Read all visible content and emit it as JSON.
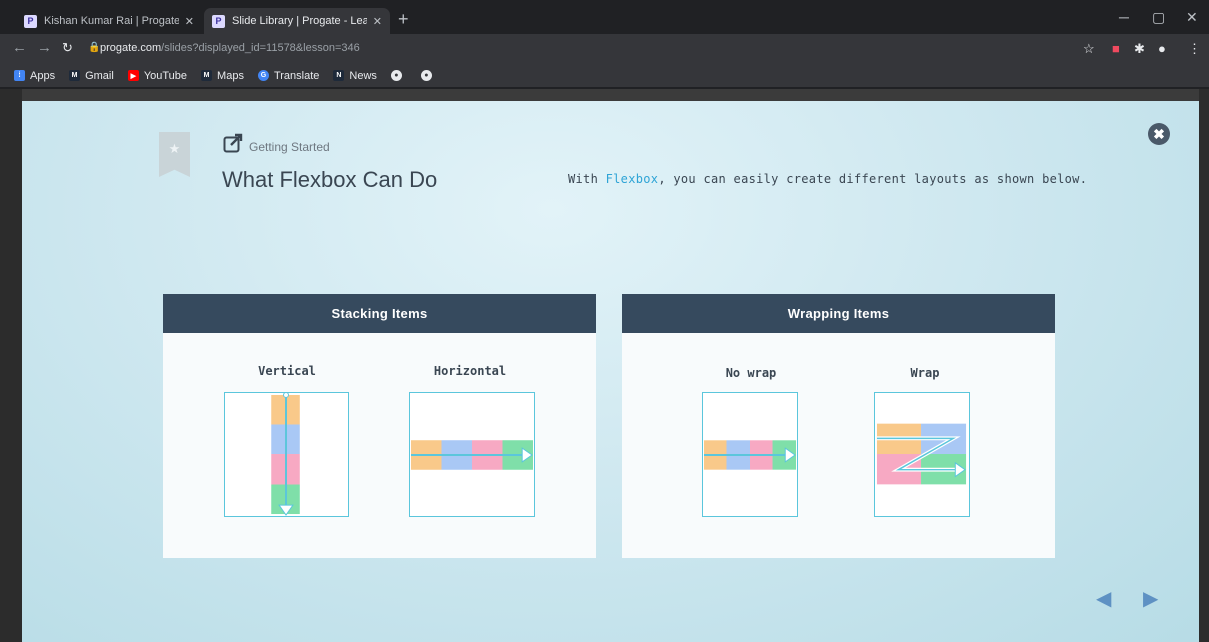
{
  "browser": {
    "tabs": [
      {
        "title": "Kishan Kumar Rai | Progate - Lea",
        "favicon": "P",
        "active": false
      },
      {
        "title": "Slide Library | Progate - Learn to",
        "favicon": "P",
        "active": true
      }
    ],
    "url_host": "progate.com",
    "url_path": "/slides?displayed_id=11578&lesson=346",
    "bookmarks": [
      {
        "label": "Apps",
        "icon_color": "#4285f4"
      },
      {
        "label": "Gmail",
        "icon_color": "#1e2a3a"
      },
      {
        "label": "YouTube",
        "icon_color": "#ff0000"
      },
      {
        "label": "Maps",
        "icon_color": "#1e2a3a"
      },
      {
        "label": "Translate",
        "icon_color": "#4285f4"
      },
      {
        "label": "News",
        "icon_color": "#1e2a3a"
      }
    ]
  },
  "slide": {
    "breadcrumb": "Getting Started",
    "title": "What Flexbox Can Do",
    "intro_before": "With ",
    "intro_highlight": "Flexbox",
    "intro_after": ", you can easily create different layouts as shown below.",
    "close_glyph": "✖",
    "stacking": {
      "header": "Stacking Items",
      "vertical_label": "Vertical",
      "horizontal_label": "Horizontal"
    },
    "wrapping": {
      "header": "Wrapping Items",
      "nowrap_label": "No wrap",
      "wrap_label": "Wrap"
    },
    "nav_prev": "◀",
    "nav_next": "▶"
  },
  "colors": {
    "accent": "#2ea4d6",
    "header_bg": "#364a5e",
    "box_orange": "#f9c98a",
    "box_blue": "#a9c8f5",
    "box_pink": "#f7a9c3",
    "box_green": "#7fdfa9",
    "arrow": "#5bc6dc"
  }
}
